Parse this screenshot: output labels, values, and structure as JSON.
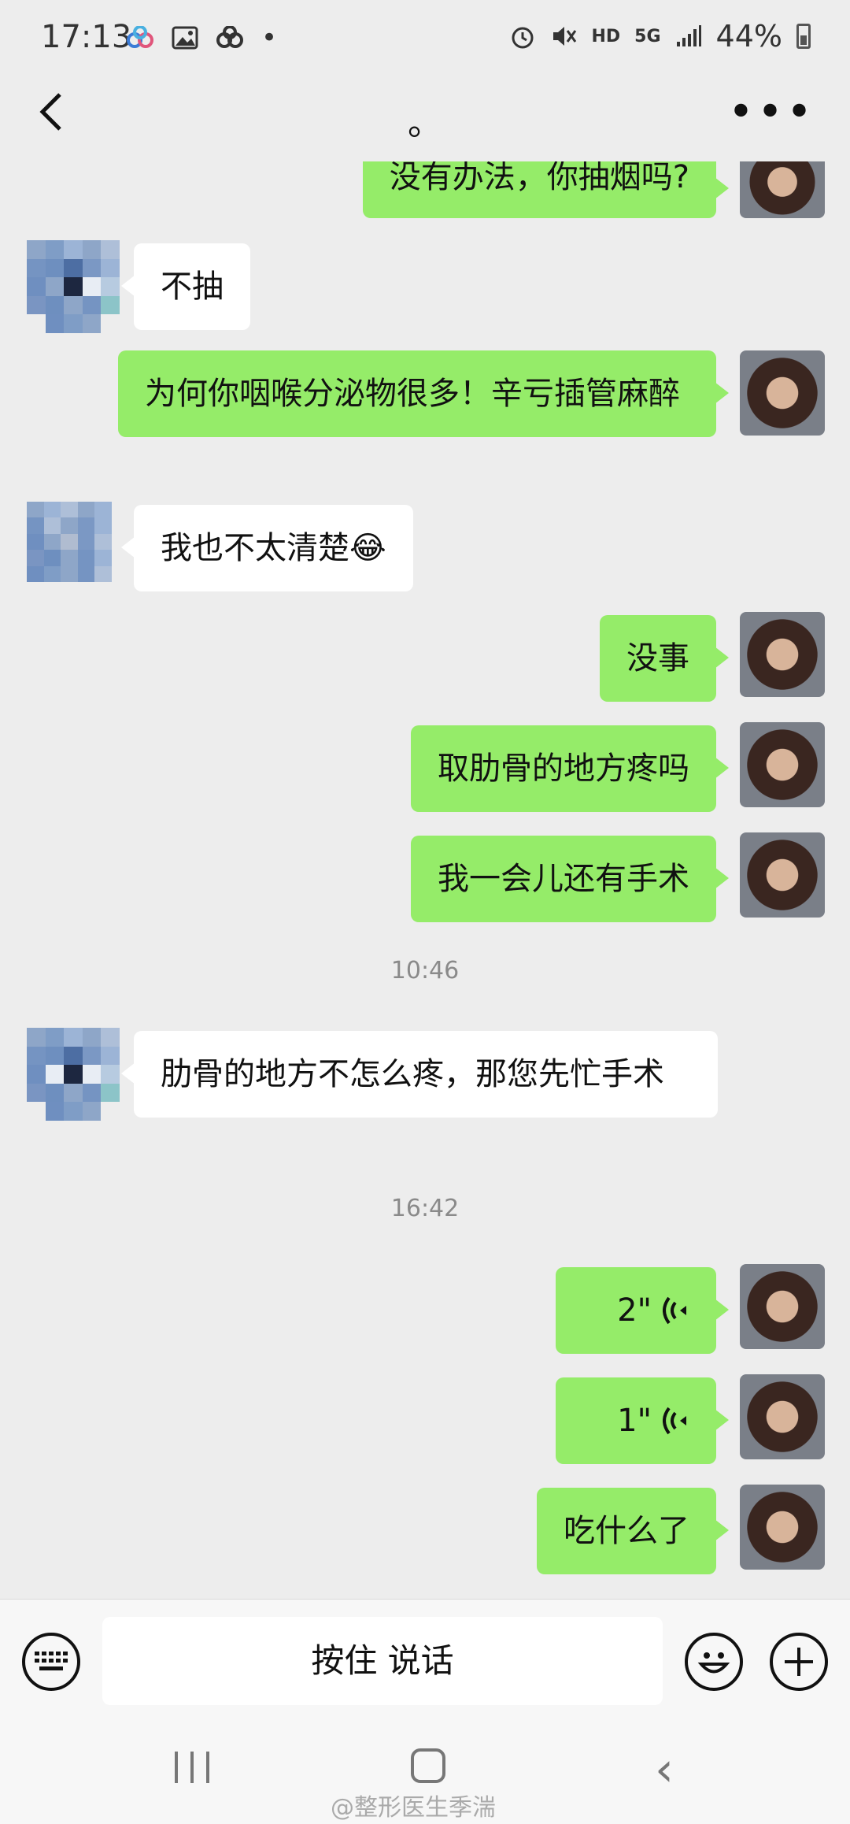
{
  "status_bar": {
    "time": "17:13",
    "network": "5G",
    "hd": "HD",
    "battery": "44%"
  },
  "header": {
    "title": "。"
  },
  "messages": [
    {
      "side": "me",
      "type": "text",
      "text": "没有办法，你抽烟吗?"
    },
    {
      "side": "them",
      "type": "text",
      "text": "不抽"
    },
    {
      "side": "me",
      "type": "text",
      "text": "为何你咽喉分泌物很多！辛亏插管麻醉"
    },
    {
      "side": "them",
      "type": "text",
      "text": "我也不太清楚😂"
    },
    {
      "side": "me",
      "type": "text",
      "text": "没事"
    },
    {
      "side": "me",
      "type": "text",
      "text": "取肋骨的地方疼吗"
    },
    {
      "side": "me",
      "type": "text",
      "text": "我一会儿还有手术"
    },
    {
      "type": "time",
      "text": "10:46"
    },
    {
      "side": "them",
      "type": "text",
      "text": "肋骨的地方不怎么疼，那您先忙手术"
    },
    {
      "type": "time",
      "text": "16:42"
    },
    {
      "side": "me",
      "type": "voice",
      "text": "2\""
    },
    {
      "side": "me",
      "type": "voice",
      "text": "1\""
    },
    {
      "side": "me",
      "type": "text",
      "text": "吃什么了"
    }
  ],
  "input_bar": {
    "hold_to_talk": "按住 说话"
  },
  "watermark": "@整形医生季湍",
  "colors": {
    "bubble_me": "#95ec69",
    "bubble_them": "#ffffff",
    "background": "#ededed"
  }
}
